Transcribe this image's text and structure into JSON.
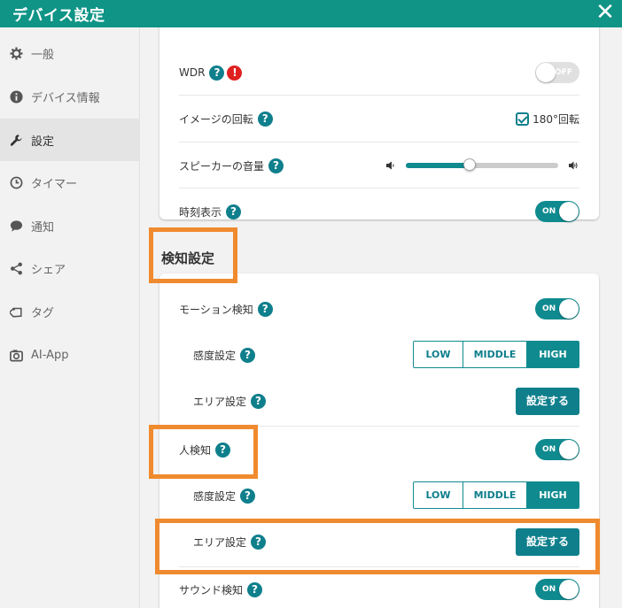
{
  "window": {
    "title": "デバイス設定",
    "close_symbol": "✕"
  },
  "sidebar": {
    "items": [
      {
        "label": "一般",
        "icon": "gear-icon",
        "active": false
      },
      {
        "label": "デバイス情報",
        "icon": "info-icon",
        "active": false
      },
      {
        "label": "設定",
        "icon": "wrench-icon",
        "active": true
      },
      {
        "label": "タイマー",
        "icon": "clock-icon",
        "active": false
      },
      {
        "label": "通知",
        "icon": "chat-bubble-icon",
        "active": false
      },
      {
        "label": "シェア",
        "icon": "share-icon",
        "active": false
      },
      {
        "label": "タグ",
        "icon": "tag-icon",
        "active": false
      },
      {
        "label": "AI-App",
        "icon": "camera-icon",
        "active": false
      }
    ]
  },
  "general_card": {
    "wdr": {
      "label": "WDR",
      "help": "?",
      "warning": "!",
      "toggle": "OFF"
    },
    "rotation": {
      "label": "イメージの回転",
      "help": "?",
      "checkbox_label": "180°回転",
      "checked": true
    },
    "speaker": {
      "label": "スピーカーの音量",
      "help": "?",
      "volume_fraction": 0.42
    },
    "time_display": {
      "label": "時刻表示",
      "help": "?",
      "toggle": "ON"
    }
  },
  "detection": {
    "section_title": "検知設定",
    "motion": {
      "label": "モーション検知",
      "help": "?",
      "toggle": "ON"
    },
    "motion_sensitivity": {
      "label": "感度設定",
      "help": "?",
      "options": [
        "LOW",
        "MIDDLE",
        "HIGH"
      ],
      "selected": "HIGH"
    },
    "motion_area": {
      "label": "エリア設定",
      "help": "?",
      "button": "設定する"
    },
    "human": {
      "label": "人検知",
      "help": "?",
      "toggle": "ON"
    },
    "human_sensitivity": {
      "label": "感度設定",
      "help": "?",
      "options": [
        "LOW",
        "MIDDLE",
        "HIGH"
      ],
      "selected": "HIGH"
    },
    "human_area": {
      "label": "エリア設定",
      "help": "?",
      "button": "設定する"
    },
    "sound": {
      "label": "サウンド検知",
      "help": "?",
      "toggle": "ON"
    }
  },
  "colors": {
    "accent": "#0f8a8f",
    "title_bar": "#0f9486",
    "highlight": "#f08a2e",
    "warning": "#e02020"
  }
}
